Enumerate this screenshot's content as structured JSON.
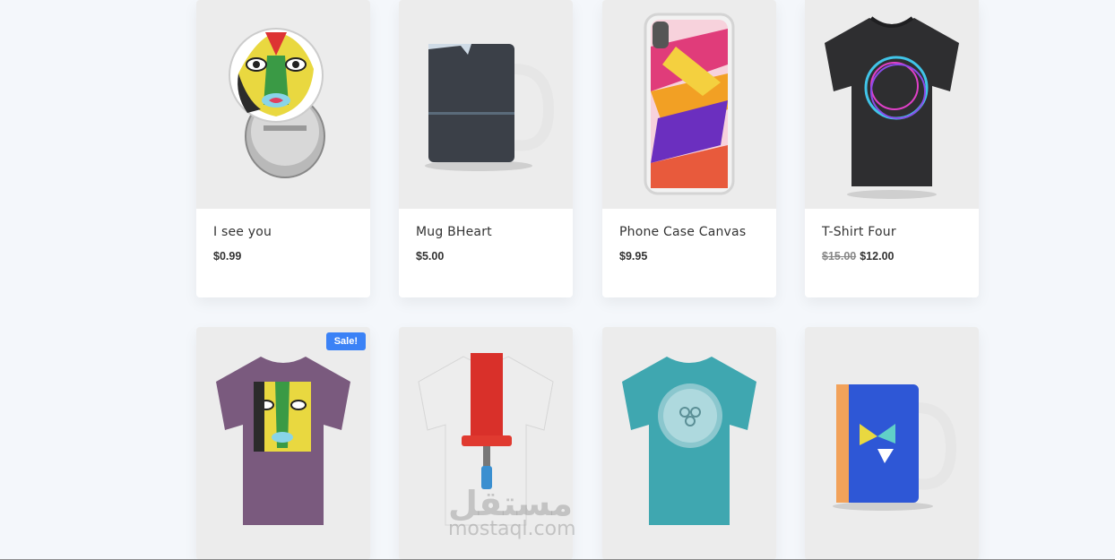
{
  "products": [
    {
      "name": "I see you",
      "price": "$0.99",
      "old_price": "",
      "badge": ""
    },
    {
      "name": "Mug BHeart",
      "price": "$5.00",
      "old_price": "",
      "badge": ""
    },
    {
      "name": "Phone Case Canvas",
      "price": "$9.95",
      "old_price": "",
      "badge": ""
    },
    {
      "name": "T-Shirt Four",
      "price": "$12.00",
      "old_price": "$15.00",
      "badge": ""
    },
    {
      "name": "",
      "price": "",
      "old_price": "",
      "badge": "Sale!"
    }
  ],
  "watermark": {
    "arabic": "مستقل",
    "latin": "mostaql.com"
  },
  "colors": {
    "badge": "#3b82f6",
    "card_bg": "#ffffff",
    "image_bg": "#ececec",
    "page_bg": "#f4f7fb"
  }
}
